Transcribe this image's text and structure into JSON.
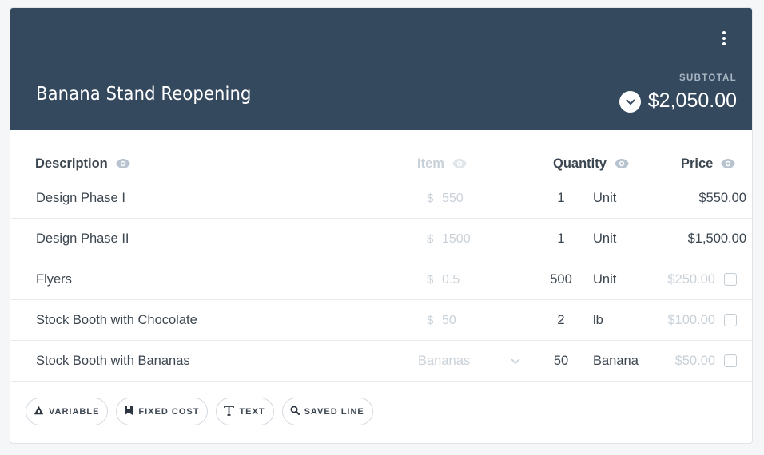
{
  "header": {
    "title": "Banana Stand Reopening",
    "subtotal_label": "SUBTOTAL",
    "subtotal_value": "$2,050.00",
    "menu_icon": "more-vertical-icon",
    "toggle_icon": "chevron-down-icon"
  },
  "columns": {
    "description": "Description",
    "item": "Item",
    "quantity": "Quantity",
    "price": "Price",
    "visibility_icon": "eye-icon"
  },
  "rows": [
    {
      "description": "Design Phase I",
      "currency": "$",
      "item": "550",
      "quantity": "1",
      "unit": "Unit",
      "price": "$550.00"
    },
    {
      "description": "Design Phase II",
      "currency": "$",
      "item": "1500",
      "quantity": "1",
      "unit": "Unit",
      "price": "$1,500.00"
    },
    {
      "description": "Flyers",
      "currency": "$",
      "item": "0.5",
      "quantity": "500",
      "unit": "Unit",
      "price": "$250.00",
      "included": false
    },
    {
      "description": "Stock Booth with Chocolate",
      "currency": "$",
      "item": "50",
      "quantity": "2",
      "unit": "lb",
      "price": "$100.00",
      "included": false
    },
    {
      "description": "Stock Booth with Bananas",
      "item_select": "Bananas",
      "quantity": "50",
      "unit": "Banana",
      "price": "$50.00",
      "included": false
    }
  ],
  "add_buttons": [
    {
      "label": "VARIABLE",
      "icon": "triangle-variable-icon"
    },
    {
      "label": "FIXED COST",
      "icon": "tag-icon"
    },
    {
      "label": "TEXT",
      "icon": "text-icon"
    },
    {
      "label": "SAVED LINE",
      "icon": "search-icon"
    }
  ],
  "colors": {
    "header_bg": "#34495e",
    "text": "#3c4650",
    "muted": "#c9d1d8"
  }
}
